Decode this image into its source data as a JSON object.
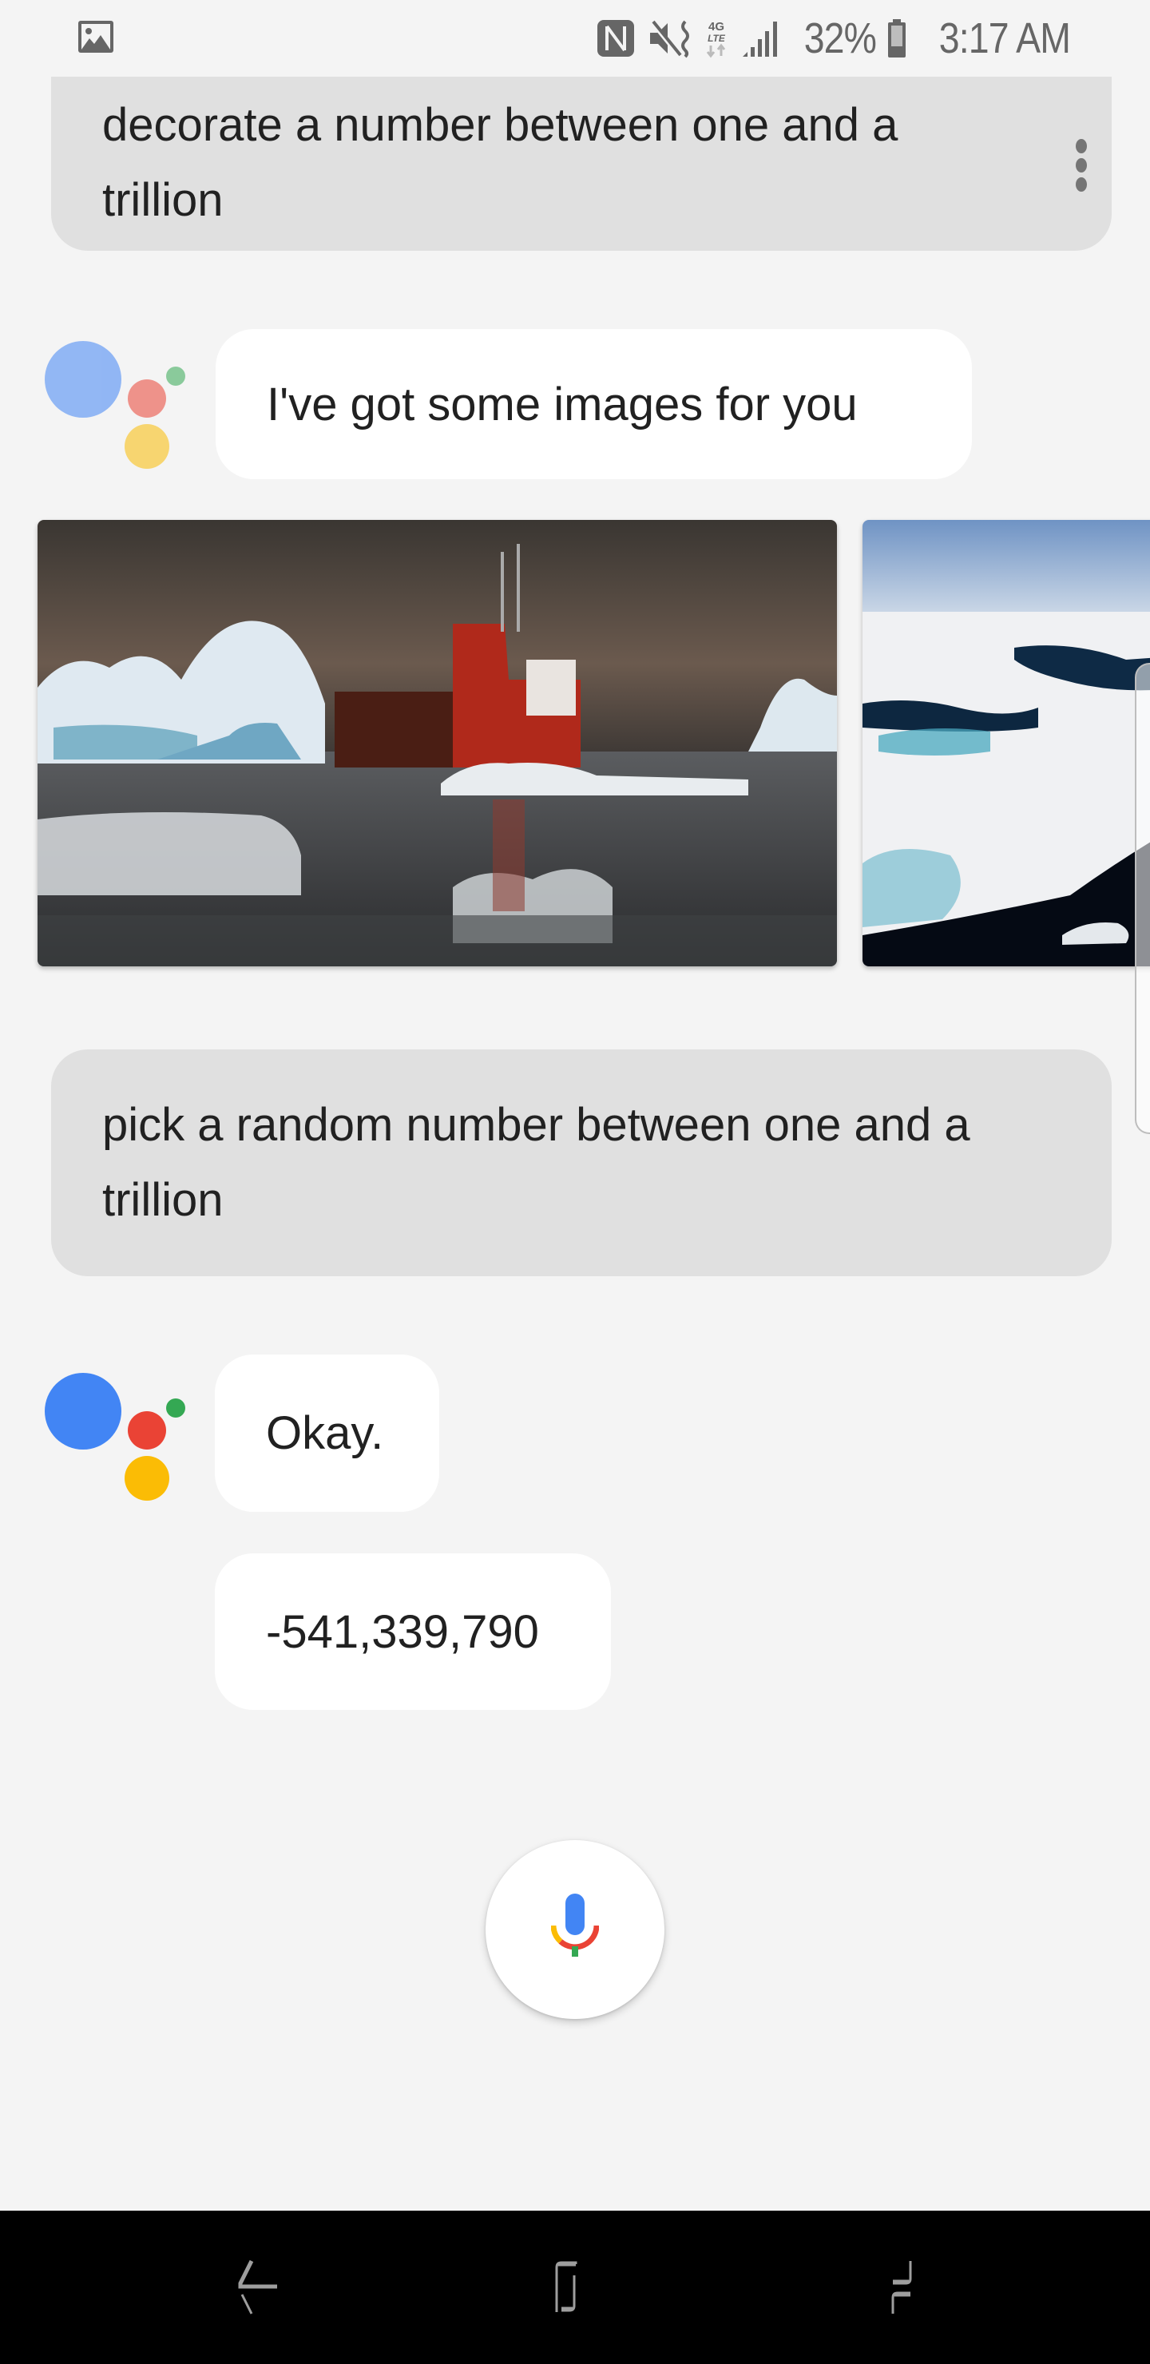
{
  "status_bar": {
    "notification_icons": [
      "gallery-icon"
    ],
    "system_icons": [
      "nfc-icon",
      "vibrate-mute-icon",
      "4g-lte-data-icon",
      "signal-icon",
      "battery-icon"
    ],
    "battery_percent": "32%",
    "time": "3:17 AM",
    "network_label_top": "4G",
    "network_label_bottom": "LTE"
  },
  "conversation": [
    {
      "role": "user",
      "text": "decorate a number between one and a trillion",
      "lines": [
        "decorate a number between one and a",
        "trillion"
      ],
      "has_overflow_menu": true
    },
    {
      "role": "assistant",
      "text": "I've got some images for you"
    },
    {
      "role": "assistant",
      "type": "image_carousel",
      "images": [
        {
          "description": "red boat among icebergs in dark water with rocky hillside"
        },
        {
          "description": "aerial view of sea ice floes and open water"
        }
      ]
    },
    {
      "role": "user",
      "text": "pick a random number between one and a trillion",
      "lines": [
        "pick a random number between one and a",
        "trillion"
      ]
    },
    {
      "role": "assistant",
      "text": "Okay."
    },
    {
      "role": "assistant",
      "text": "-541,339,790"
    }
  ],
  "input": {
    "mic_icon": "microphone-icon"
  },
  "nav_bar": {
    "buttons": [
      "back",
      "home",
      "recent-apps"
    ]
  },
  "colors": {
    "background": "#f4f4f4",
    "user_bubble": "#e0e0e0",
    "assistant_bubble": "#ffffff",
    "google_blue": "#4285f4",
    "google_red": "#ea4335",
    "google_yellow": "#fbbc05",
    "google_green": "#34a853",
    "nav_bar": "#000000"
  }
}
